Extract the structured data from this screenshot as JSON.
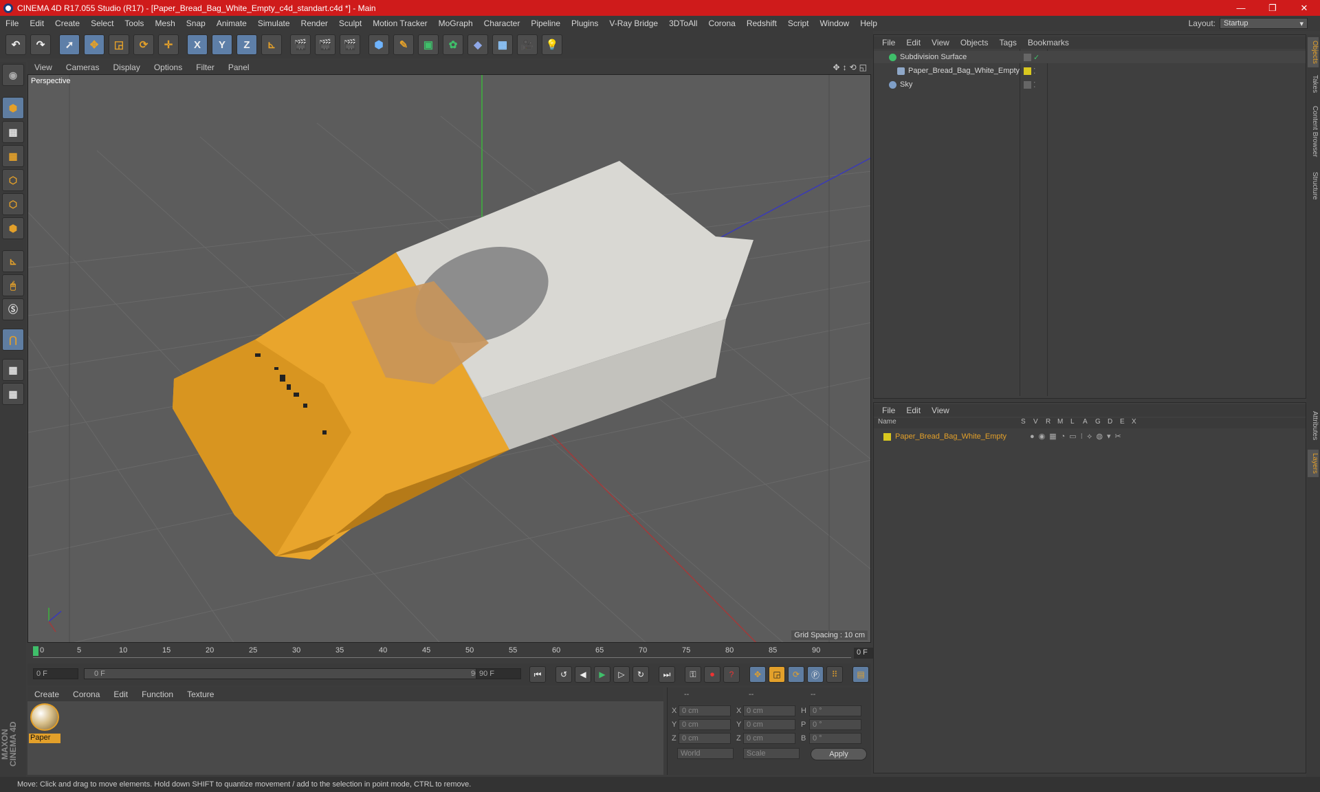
{
  "window": {
    "title": "CINEMA 4D R17.055 Studio (R17) - [Paper_Bread_Bag_White_Empty_c4d_standart.c4d *] - Main",
    "controls": [
      "—",
      "❐",
      "✕"
    ]
  },
  "menubar": {
    "items": [
      "File",
      "Edit",
      "Create",
      "Select",
      "Tools",
      "Mesh",
      "Snap",
      "Animate",
      "Simulate",
      "Render",
      "Sculpt",
      "Motion Tracker",
      "MoGraph",
      "Character",
      "Pipeline",
      "Plugins",
      "V-Ray Bridge",
      "3DToAll",
      "Corona",
      "Redshift",
      "Script",
      "Window",
      "Help"
    ],
    "layout_label": "Layout:",
    "layout_value": "Startup"
  },
  "toolbar": {
    "axis_x": "X",
    "axis_y": "Y",
    "axis_z": "Z"
  },
  "viewport": {
    "menu": [
      "View",
      "Cameras",
      "Display",
      "Options",
      "Filter",
      "Panel"
    ],
    "label": "Perspective",
    "grid_spacing": "Grid Spacing : 10 cm"
  },
  "timeline": {
    "ticks": [
      "0",
      "5",
      "10",
      "15",
      "20",
      "25",
      "30",
      "35",
      "40",
      "45",
      "50",
      "55",
      "60",
      "65",
      "70",
      "75",
      "80",
      "85",
      "90"
    ],
    "current_frame": "0 F"
  },
  "transport": {
    "start_field": "0 F",
    "range_start": "0 F",
    "range_end": "90 F",
    "end_field": "90 F"
  },
  "materials": {
    "menu": [
      "Create",
      "Corona",
      "Edit",
      "Function",
      "Texture"
    ],
    "items": [
      {
        "name": "Paper"
      }
    ]
  },
  "coordinates": {
    "header": [
      "--",
      "--",
      "--"
    ],
    "rows": [
      {
        "l1": "X",
        "v1": "0 cm",
        "l2": "X",
        "v2": "0 cm",
        "l3": "H",
        "v3": "0 °"
      },
      {
        "l1": "Y",
        "v1": "0 cm",
        "l2": "Y",
        "v2": "0 cm",
        "l3": "P",
        "v3": "0 °"
      },
      {
        "l1": "Z",
        "v1": "0 cm",
        "l2": "Z",
        "v2": "0 cm",
        "l3": "B",
        "v3": "0 °"
      }
    ],
    "mode1": "World",
    "mode2": "Scale",
    "apply": "Apply"
  },
  "object_manager": {
    "menu": [
      "File",
      "Edit",
      "View",
      "Objects",
      "Tags",
      "Bookmarks"
    ],
    "objects": [
      {
        "name": "Subdivision Surface",
        "icon_color": "#3fbf6a"
      },
      {
        "name": "Paper_Bread_Bag_White_Empty",
        "icon_color": "#8fa8c8"
      },
      {
        "name": "Sky",
        "icon_color": "#7f9fc8"
      }
    ]
  },
  "layer_manager": {
    "menu": [
      "File",
      "Edit",
      "View"
    ],
    "columns": [
      "Name",
      "S",
      "V",
      "R",
      "M",
      "L",
      "A",
      "G",
      "D",
      "E",
      "X"
    ],
    "layers": [
      {
        "name": "Paper_Bread_Bag_White_Empty",
        "color": "#d9c81f"
      }
    ]
  },
  "side_tabs": [
    "Objects",
    "Takes",
    "Content Browser",
    "Structure",
    "Attributes",
    "Layers"
  ],
  "statusbar": "Move: Click and drag to move elements. Hold down SHIFT to quantize movement / add to the selection in point mode, CTRL to remove.",
  "brand": "MAXON CINEMA 4D",
  "colors": {
    "accent": "#e3a02a",
    "titlebar": "#cf1b1b",
    "bag_orange": "#e9a52c",
    "bag_white": "#d7d6d1"
  }
}
